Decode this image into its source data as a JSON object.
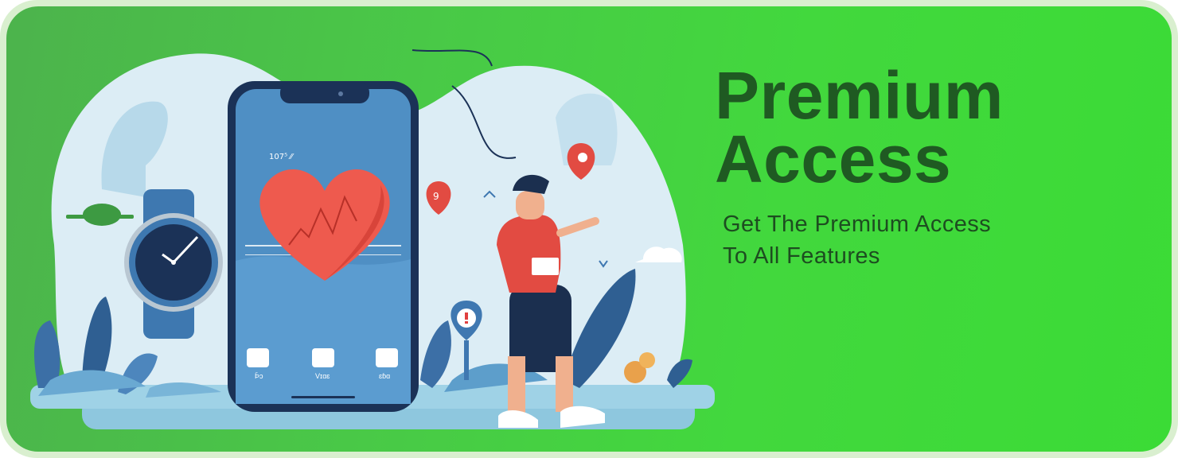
{
  "banner": {
    "title_line1": "Premium",
    "title_line2": "Access",
    "subtitle_line1": "Get The Premium Access",
    "subtitle_line2": "To All Features"
  },
  "phone_screen": {
    "status": "107⁵ ⁄⁄",
    "app_labels": [
      "Þ̄ɔ",
      "Vɪɑɛ",
      "ɛɓɑ"
    ]
  },
  "illustration": {
    "icons": [
      "smartwatch-icon",
      "smartphone-icon",
      "heart-rate-icon",
      "location-pin-icon",
      "alert-icon",
      "runner-icon"
    ]
  },
  "colors": {
    "background": "#45d43f",
    "title": "#1f5a22",
    "subtitle": "#1d4d20",
    "heart": "#ee5a4e",
    "phone_frame": "#1b3257",
    "screen": "#4f8fc4",
    "blob": "#dcedf5"
  }
}
